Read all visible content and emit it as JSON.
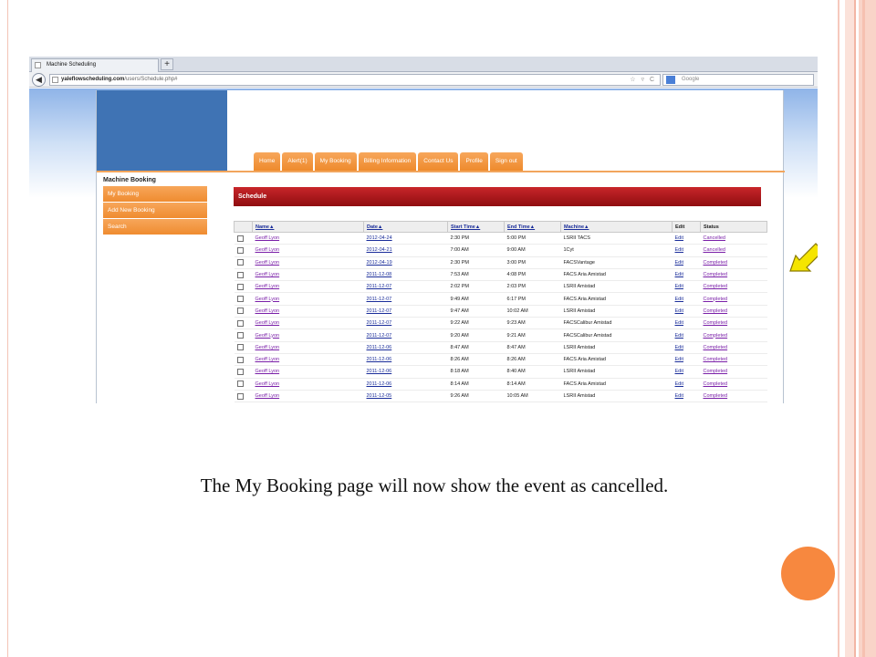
{
  "browser": {
    "tab_title": "Machine Scheduling",
    "new_tab": "+",
    "url_host": "yaleflowscheduling.com",
    "url_path": "/users/Schedule.php#",
    "url_icons": "☆ ▿ C",
    "search_placeholder": "Google"
  },
  "nav": {
    "items": [
      "Home",
      "Alert(1)",
      "My Booking",
      "Billing Information",
      "Contact Us",
      "Profile",
      "Sign out"
    ]
  },
  "sidebar": {
    "title": "Machine Booking",
    "items": [
      "My Booking",
      "Add New Booking",
      "Search"
    ]
  },
  "schedule": {
    "title": "Schedule",
    "columns": [
      "Name▲",
      "Date▲",
      "Start Time▲",
      "End Time▲",
      "Machine▲",
      "Edit",
      "Status"
    ],
    "rows": [
      {
        "name": "Geoff Lyon",
        "date": "2012-04-24",
        "start": "2:30 PM",
        "end": "5:00 PM",
        "machine": "LSRII TACS",
        "edit": "Edit",
        "status": "Cancelled"
      },
      {
        "name": "Geoff Lyon",
        "date": "2012-04-21",
        "start": "7:00 AM",
        "end": "9:00 AM",
        "machine": "1Cyt",
        "edit": "Edit",
        "status": "Cancelled"
      },
      {
        "name": "Geoff Lyon",
        "date": "2012-04-19",
        "start": "2:30 PM",
        "end": "3:00 PM",
        "machine": "FACSVantage",
        "edit": "Edit",
        "status": "Completed"
      },
      {
        "name": "Geoff Lyon",
        "date": "2011-12-08",
        "start": "7:53 AM",
        "end": "4:08 PM",
        "machine": "FACS Aria Amistad",
        "edit": "Edit",
        "status": "Completed"
      },
      {
        "name": "Geoff Lyon",
        "date": "2011-12-07",
        "start": "2:02 PM",
        "end": "2:03 PM",
        "machine": "LSRII Amistad",
        "edit": "Edit",
        "status": "Completed"
      },
      {
        "name": "Geoff Lyon",
        "date": "2011-12-07",
        "start": "9:49 AM",
        "end": "6:17 PM",
        "machine": "FACS Aria Amistad",
        "edit": "Edit",
        "status": "Completed"
      },
      {
        "name": "Geoff Lyon",
        "date": "2011-12-07",
        "start": "9:47 AM",
        "end": "10:02 AM",
        "machine": "LSRII Amistad",
        "edit": "Edit",
        "status": "Completed"
      },
      {
        "name": "Geoff Lyon",
        "date": "2011-12-07",
        "start": "9:22 AM",
        "end": "9:23 AM",
        "machine": "FACSCalibur Amistad",
        "edit": "Edit",
        "status": "Completed"
      },
      {
        "name": "Geoff Lyon",
        "date": "2011-12-07",
        "start": "9:20 AM",
        "end": "9:21 AM",
        "machine": "FACSCalibur Amistad",
        "edit": "Edit",
        "status": "Completed"
      },
      {
        "name": "Geoff Lyon",
        "date": "2011-12-06",
        "start": "8:47 AM",
        "end": "8:47 AM",
        "machine": "LSRII Amistad",
        "edit": "Edit",
        "status": "Completed"
      },
      {
        "name": "Geoff Lyon",
        "date": "2011-12-06",
        "start": "8:26 AM",
        "end": "8:26 AM",
        "machine": "FACS Aria Amistad",
        "edit": "Edit",
        "status": "Completed"
      },
      {
        "name": "Geoff Lyon",
        "date": "2011-12-06",
        "start": "8:18 AM",
        "end": "8:40 AM",
        "machine": "LSRII Amistad",
        "edit": "Edit",
        "status": "Completed"
      },
      {
        "name": "Geoff Lyon",
        "date": "2011-12-06",
        "start": "8:14 AM",
        "end": "8:14 AM",
        "machine": "FACS Aria Amistad",
        "edit": "Edit",
        "status": "Completed"
      },
      {
        "name": "Geoff Lyon",
        "date": "2011-12-05",
        "start": "9:26 AM",
        "end": "10:05 AM",
        "machine": "LSRII Amistad",
        "edit": "Edit",
        "status": "Completed"
      }
    ]
  },
  "caption": "The My Booking page will now show the event as cancelled.",
  "colors": {
    "accent_orange": "#ef8c30",
    "schedule_red": "#b01a1e",
    "logo_blue": "#3f73b4",
    "arrow_yellow": "#f5e500"
  }
}
